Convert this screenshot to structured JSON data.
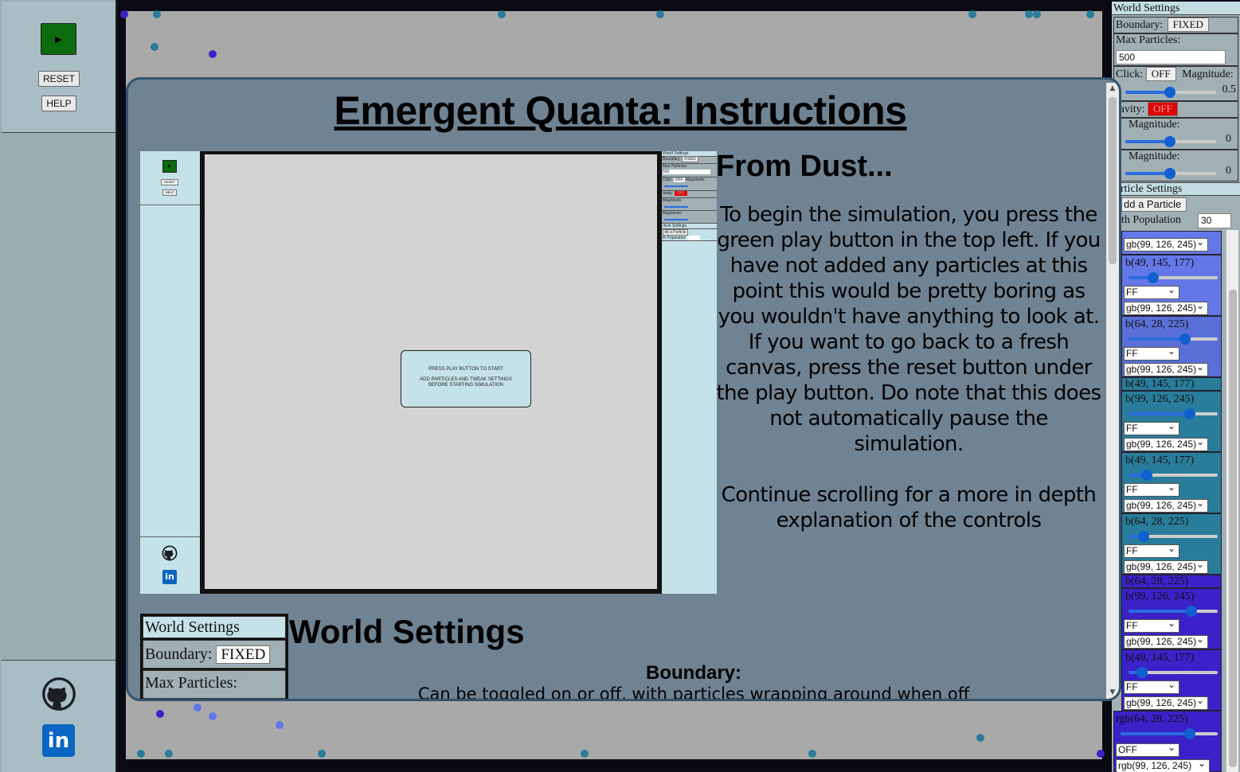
{
  "left_panel": {
    "play_label": "▶",
    "reset_label": "RESET",
    "help_label": "HELP"
  },
  "world_settings": {
    "title": "World Settings",
    "boundary_label": "Boundary:",
    "boundary_value": "FIXED",
    "max_particles_label": "Max Particles:",
    "max_particles_value": "500",
    "click_label": "Click:",
    "click_value": "OFF",
    "click_magnitude_label": "Magnitude:",
    "click_magnitude_value": "0.5",
    "gravity_label": "ravity:",
    "gravity_value": "OFF",
    "x_magnitude_label": "Magnitude:",
    "x_magnitude_value": "0",
    "y_magnitude_label": "Magnitude:",
    "y_magnitude_value": "0"
  },
  "particle_settings": {
    "title": "rticle Settings",
    "add_label": "dd a Particle",
    "population_label": "th Population",
    "population_value": "30",
    "groups": [
      {
        "color": "#6377e6",
        "name": "b(49, 145, 177)",
        "select_top": "gb(99, 126, 245)",
        "toggle": "FF",
        "select_bottom": "gb(99, 126, 245)",
        "slider": 0.3
      },
      {
        "color": "#5a70d8",
        "name": "b(64, 28, 225)",
        "select_top": "",
        "toggle": "FF",
        "select_bottom": "gb(99, 126, 245)",
        "slider": 0.6
      },
      {
        "color": "#2a7d9a",
        "name": "b(99, 126, 245)",
        "select_top": "",
        "toggle": "FF",
        "select_bottom": "gb(99, 126, 245)",
        "slider": 0.65
      },
      {
        "color": "#2a7d9a",
        "name": "b(49, 145, 177)",
        "select_top": "",
        "toggle": "FF",
        "select_bottom": "gb(99, 126, 245)",
        "slider": 0.2
      },
      {
        "color": "#2a7d9a",
        "name": "b(64, 28, 225)",
        "select_top": "",
        "toggle": "FF",
        "select_bottom": "gb(99, 126, 245)",
        "slider": 0.17
      },
      {
        "color": "#3a22c8",
        "name": "b(99, 126, 245)",
        "select_top": "",
        "toggle": "FF",
        "select_bottom": "gb(99, 126, 245)",
        "slider": 0.68
      },
      {
        "color": "#3a22c8",
        "name": "b(49, 145, 177)",
        "select_top": "",
        "toggle": "FF",
        "select_bottom": "gb(99, 126, 245)",
        "slider": 0.15
      }
    ],
    "group_headers": [
      "b(49, 145, 177)",
      "b(64, 28, 225)"
    ],
    "last_name": "rgb(64, 28, 225)",
    "last_toggle": "OFF",
    "last_select": "rgb(99, 126, 245)",
    "first_select": "rgb(99, 126, 245)"
  },
  "modal": {
    "title": "Emergent Quanta: Instructions",
    "section1_heading": "From Dust...",
    "section1_para": "To begin the simulation, you press the green play button in the top left. If you have not added any particles at this point this would be pretty boring as you wouldn't have anything to look at. If you want to go back to a fresh canvas, press the reset button under the play button. Do note that this does not automatically pause the simulation.",
    "section1_para2": "Continue scrolling for a more in depth explanation of the controls",
    "preview_dialog_line1": "PRESS PLAY BUTTON TO START",
    "preview_dialog_line2": "ADD PARTICLES AND TWEAK SETTINGS BEFORE STARTING SIMULATION",
    "section2_heading": "World Settings",
    "ws_title": "World Settings",
    "ws_boundary_label": "Boundary:",
    "ws_boundary_value": "FIXED",
    "ws_max_label": "Max Particles:",
    "boundary_heading": "Boundary:",
    "boundary_text": "Can be toggled on or off, with particles wrapping around when off"
  },
  "colors": {
    "play": "#0c6b0c",
    "modal_bg": "#708393",
    "panel_light": "#c5e2e8",
    "gravity_off": "#e00000"
  }
}
